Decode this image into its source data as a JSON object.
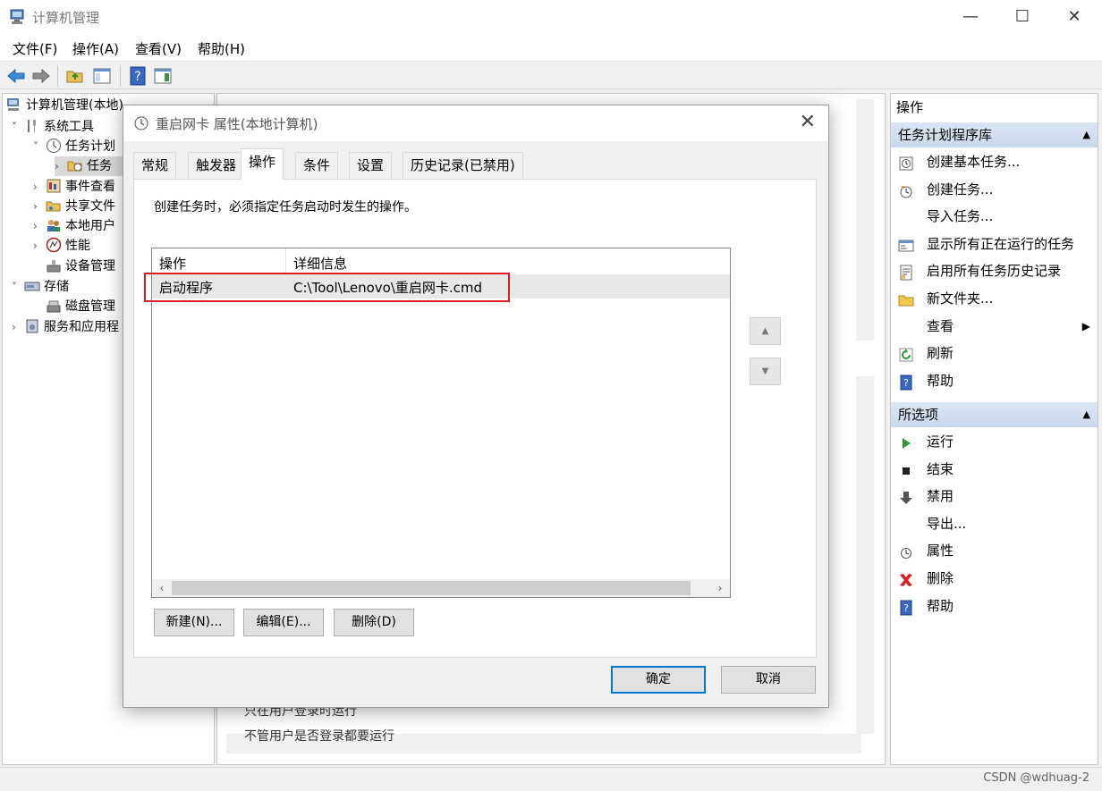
{
  "window": {
    "title": "计算机管理",
    "minimize": "—",
    "maximize": "☐",
    "close": "✕"
  },
  "menu": [
    "文件(F)",
    "操作(A)",
    "查看(V)",
    "帮助(H)"
  ],
  "tree": {
    "root": "计算机管理(本地)",
    "items": [
      {
        "label": "系统工具",
        "exp": "˅"
      },
      {
        "label": "任务计划",
        "exp": "˅"
      },
      {
        "label": "任务",
        "exp": "›"
      },
      {
        "label": "事件查看",
        "exp": "›"
      },
      {
        "label": "共享文件",
        "exp": "›"
      },
      {
        "label": "本地用户",
        "exp": "›"
      },
      {
        "label": "性能",
        "exp": "›"
      },
      {
        "label": "设备管理",
        "exp": ""
      },
      {
        "label": "存储",
        "exp": "˅"
      },
      {
        "label": "磁盘管理",
        "exp": ""
      },
      {
        "label": "服务和应用程",
        "exp": "›"
      }
    ]
  },
  "middle": {
    "peek1": "只在用户登录时运行",
    "peek2": "不管用户是否登录都要运行"
  },
  "actions": {
    "header": "操作",
    "section1": {
      "title": "任务计划程序库",
      "items": [
        {
          "label": "创建基本任务...",
          "icon": "create-basic-task-icon"
        },
        {
          "label": "创建任务...",
          "icon": "create-task-icon"
        },
        {
          "label": "导入任务...",
          "icon": ""
        },
        {
          "label": "显示所有正在运行的任务",
          "icon": "running-tasks-icon"
        },
        {
          "label": "启用所有任务历史记录",
          "icon": "history-icon"
        },
        {
          "label": "新文件夹...",
          "icon": "folder-icon"
        },
        {
          "label": "查看",
          "icon": "",
          "arrow": "▶"
        },
        {
          "label": "刷新",
          "icon": "refresh-icon"
        },
        {
          "label": "帮助",
          "icon": "help-icon"
        }
      ]
    },
    "section2": {
      "title": "所选项",
      "items": [
        {
          "label": "运行",
          "icon": "run-icon"
        },
        {
          "label": "结束",
          "icon": "stop-icon"
        },
        {
          "label": "禁用",
          "icon": "disable-icon"
        },
        {
          "label": "导出...",
          "icon": ""
        },
        {
          "label": "属性",
          "icon": "properties-icon"
        },
        {
          "label": "删除",
          "icon": "delete-icon"
        },
        {
          "label": "帮助",
          "icon": "help-icon"
        }
      ]
    }
  },
  "status": {
    "watermark": "CSDN @wdhuag-2"
  },
  "dialog": {
    "title": "重启网卡 属性(本地计算机)",
    "close": "✕",
    "tabs": [
      "常规",
      "触发器",
      "操作",
      "条件",
      "设置",
      "历史记录(已禁用)"
    ],
    "active_tab": "操作",
    "description": "创建任务时，必须指定任务启动时发生的操作。",
    "grid": {
      "columns": [
        "操作",
        "详细信息"
      ],
      "rows": [
        {
          "action": "启动程序",
          "details": "C:\\Tool\\Lenovo\\重启网卡.cmd"
        }
      ]
    },
    "buttons": {
      "new": "新建(N)...",
      "edit": "编辑(E)...",
      "delete": "删除(D)",
      "ok": "确定",
      "cancel": "取消"
    }
  }
}
